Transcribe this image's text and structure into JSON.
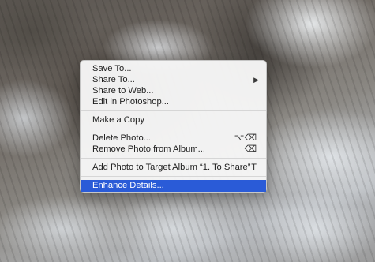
{
  "background": {
    "description_icon": "mountain-photo"
  },
  "context_menu": {
    "groups": [
      {
        "items": [
          {
            "label": "Save To...",
            "shortcut": "",
            "submenu": false
          },
          {
            "label": "Share To...",
            "shortcut": "",
            "submenu": true,
            "arrow": "▶"
          },
          {
            "label": "Share to Web...",
            "shortcut": "",
            "submenu": false
          },
          {
            "label": "Edit in Photoshop...",
            "shortcut": "",
            "submenu": false
          }
        ]
      },
      {
        "items": [
          {
            "label": "Make a Copy",
            "shortcut": "",
            "submenu": false
          }
        ]
      },
      {
        "items": [
          {
            "label": "Delete Photo...",
            "shortcut": "⌥⌫",
            "submenu": false
          },
          {
            "label": "Remove Photo from Album...",
            "shortcut": "⌫",
            "submenu": false
          }
        ]
      },
      {
        "items": [
          {
            "label": "Add Photo to Target Album “1. To Share”",
            "shortcut": "T",
            "submenu": false
          }
        ]
      },
      {
        "items": [
          {
            "label": "Enhance Details...",
            "shortcut": "",
            "submenu": false,
            "highlighted": true
          }
        ]
      }
    ],
    "highlight_color": "#2a5bd7"
  }
}
